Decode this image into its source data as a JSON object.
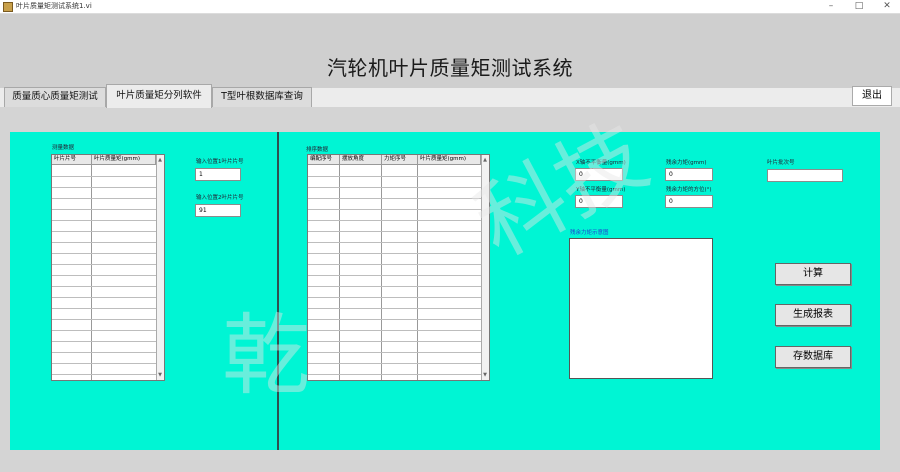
{
  "window": {
    "title": "叶片质量矩测试系统1.vi",
    "minimize_glyph": "–",
    "maximize_glyph": "□",
    "close_glyph": "✕"
  },
  "header": {
    "title": "汽轮机叶片质量矩测试系统"
  },
  "tabs": [
    {
      "label": "质量质心质量矩测试"
    },
    {
      "label": "叶片质量矩分列软件",
      "active": true
    },
    {
      "label": "T型叶根数据库查询"
    }
  ],
  "exit_button": "退出",
  "measure_section": {
    "title": "测量数据",
    "columns": [
      "叶片片号",
      "叶片质量矩(gmm)"
    ],
    "row_count": 20
  },
  "inputs": {
    "pos1_label": "输入位置1叶片片号",
    "pos1_value": "1",
    "pos2_label": "输入位置2叶片片号",
    "pos2_value": "91"
  },
  "sort_section": {
    "title": "排序数据",
    "columns": [
      "编配序号",
      "摆放角度",
      "力矩序号",
      "叶片质量矩(gmm)"
    ],
    "row_count": 20
  },
  "results": {
    "x_unbalance_label": "X轴不平衡量(gmm)",
    "x_unbalance_value": "0",
    "y_unbalance_label": "Y轴不平衡量(gmm)",
    "y_unbalance_value": "0",
    "residual_label": "残余力矩(gmm)",
    "residual_value": "0",
    "residual_angle_label": "残余力矩的方位(°)",
    "residual_angle_value": "0",
    "batch_label": "叶片批次号",
    "batch_value": ""
  },
  "plot": {
    "title": "残余力矩示意图"
  },
  "buttons": {
    "calculate": "计算",
    "report": "生成报表",
    "save_db": "存数据库"
  },
  "watermark": {
    "left": "乾",
    "right": "科技"
  }
}
